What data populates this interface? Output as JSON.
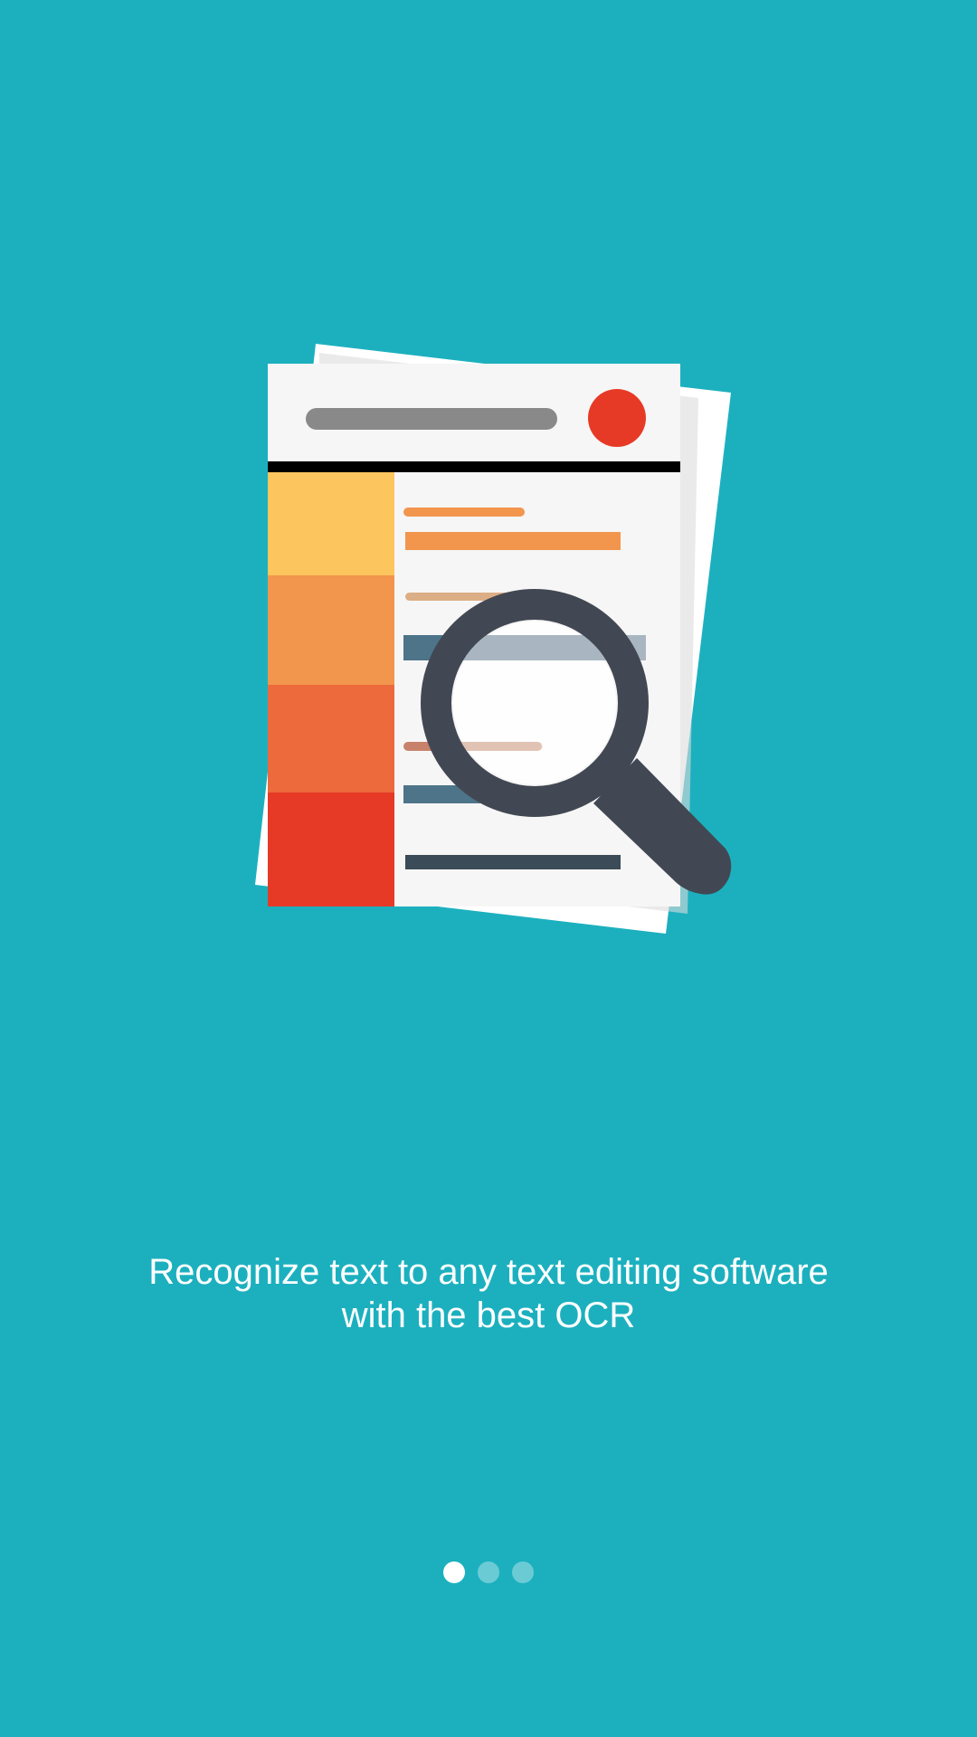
{
  "onboarding": {
    "caption_line1": "Recognize text to any text editing software",
    "caption_line2": "with the best OCR",
    "illustration_icon": "document-magnifier-icon",
    "pager": {
      "total": 3,
      "active_index": 0
    }
  },
  "colors": {
    "background": "#1cb0bf",
    "paper": "#f7f6f6",
    "magnifier": "#424853",
    "accent_red": "#e63a27",
    "accent_orange": "#f2954d",
    "accent_yellow": "#fdc55d"
  }
}
